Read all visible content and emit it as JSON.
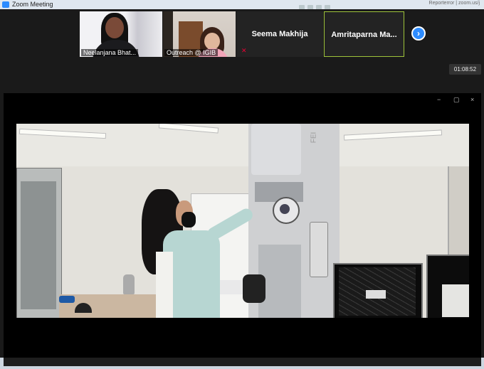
{
  "app": {
    "title": "Zoom Meeting",
    "top_right_text": "Reporterror   |   zoom.us/j"
  },
  "participants": [
    {
      "name": "Neelanjana Bhat..."
    },
    {
      "name": "Outreach @ IGIB"
    },
    {
      "name": "Seema Makhija"
    },
    {
      "name": "Amritaparna  Ma..."
    }
  ],
  "controls": {
    "next_page": "›",
    "timer": "01:08:52"
  },
  "window_controls": {
    "minimize": "−",
    "restore": "▢",
    "close": "×"
  },
  "video": {
    "equipment_label": "FEI"
  }
}
